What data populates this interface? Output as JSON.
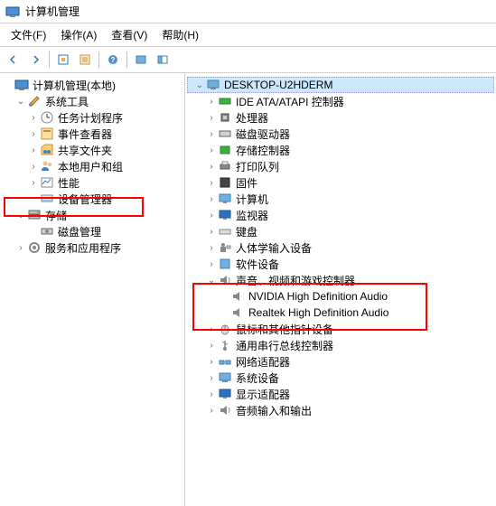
{
  "window": {
    "title": "计算机管理"
  },
  "menubar": {
    "file": "文件(F)",
    "action": "操作(A)",
    "view": "查看(V)",
    "help": "帮助(H)"
  },
  "leftTree": {
    "root": "计算机管理(本地)",
    "systemTools": "系统工具",
    "taskScheduler": "任务计划程序",
    "eventViewer": "事件查看器",
    "sharedFolders": "共享文件夹",
    "localUsers": "本地用户和组",
    "performance": "性能",
    "deviceManager": "设备管理器",
    "storage": "存储",
    "diskMgmt": "磁盘管理",
    "services": "服务和应用程序"
  },
  "rightTree": {
    "computer": "DESKTOP-U2HDERM",
    "ide": "IDE ATA/ATAPI 控制器",
    "cpu": "处理器",
    "diskDrive": "磁盘驱动器",
    "storageCtrl": "存储控制器",
    "printQueue": "打印队列",
    "firmware": "固件",
    "computers": "计算机",
    "monitor": "监视器",
    "keyboard": "键盘",
    "hid": "人体学输入设备",
    "software": "软件设备",
    "sound": "声音、视频和游戏控制器",
    "nvidia": "NVIDIA High Definition Audio",
    "realtek": "Realtek High Definition Audio",
    "mouse": "鼠标和其他指针设备",
    "usb": "通用串行总线控制器",
    "network": "网络适配器",
    "system": "系统设备",
    "display": "显示适配器",
    "audioIO": "音频输入和输出"
  }
}
